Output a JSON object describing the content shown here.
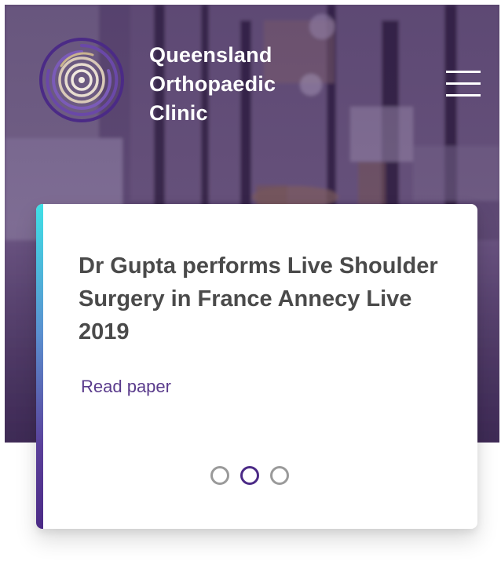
{
  "header": {
    "brand_lines": [
      "Queensland",
      "Orthopaedic",
      "Clinic"
    ],
    "menu_icon": "hamburger-menu-icon",
    "logo_icon": "concentric-rings-logo-icon"
  },
  "slide": {
    "title": "Dr Gupta performs Live Shoulder Surgery in France Annecy Live 2019",
    "link_label": "Read paper"
  },
  "carousel": {
    "total_slides": 3,
    "active_index": 1
  },
  "colors": {
    "accent_purple": "#4b2a86",
    "accent_cyan": "#3fe0e6",
    "title_text": "#4a4a4a",
    "link_text": "#5a3b8c",
    "dot_inactive": "#9a9a9a"
  }
}
